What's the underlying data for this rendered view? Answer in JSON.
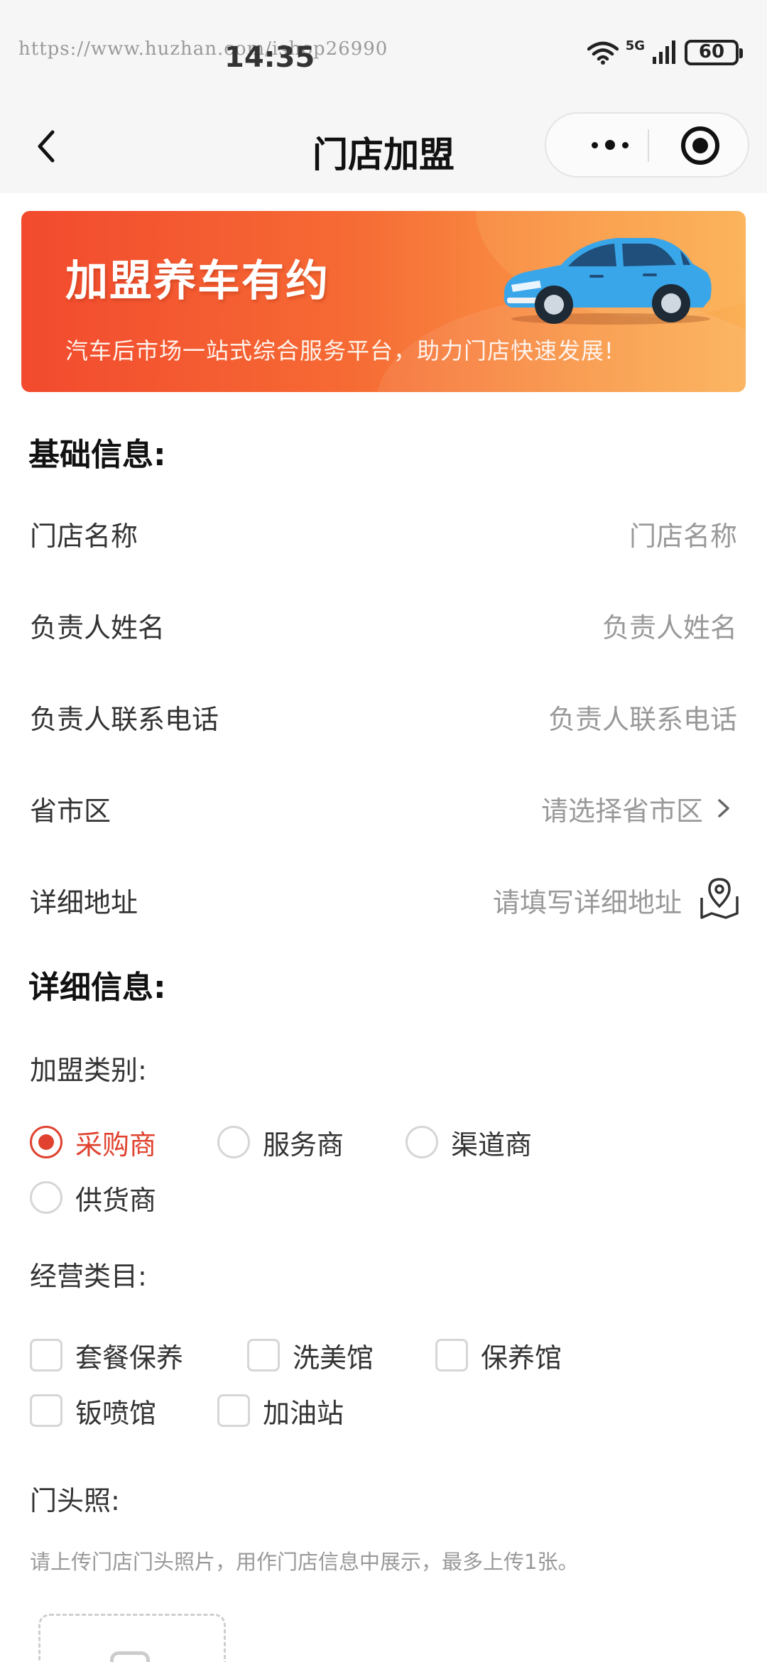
{
  "status_bar": {
    "watermark": "https://www.huzhan.com/ishop26990",
    "time": "14:35",
    "network": "5G",
    "battery": "60"
  },
  "nav": {
    "title": "门店加盟"
  },
  "banner": {
    "title": "加盟养车有约",
    "subtitle": "汽车后市场一站式综合服务平台，助力门店快速发展!"
  },
  "basic_info": {
    "section_title": "基础信息:",
    "fields": [
      {
        "label": "门店名称",
        "placeholder": "门店名称"
      },
      {
        "label": "负责人姓名",
        "placeholder": "负责人姓名"
      },
      {
        "label": "负责人联系电话",
        "placeholder": "负责人联系电话"
      },
      {
        "label": "省市区",
        "placeholder": "请选择省市区"
      },
      {
        "label": "详细地址",
        "placeholder": "请填写详细地址"
      }
    ]
  },
  "detail_info": {
    "section_title": "详细信息:",
    "category_label": "加盟类别:",
    "categories": [
      {
        "label": "采购商",
        "selected": true
      },
      {
        "label": "服务商",
        "selected": false
      },
      {
        "label": "渠道商",
        "selected": false
      },
      {
        "label": "供货商",
        "selected": false
      }
    ],
    "business_label": "经营类目:",
    "businesses": [
      {
        "label": "套餐保养",
        "checked": false
      },
      {
        "label": "洗美馆",
        "checked": false
      },
      {
        "label": "保养馆",
        "checked": false
      },
      {
        "label": "钣喷馆",
        "checked": false
      },
      {
        "label": "加油站",
        "checked": false
      }
    ],
    "photo_label": "门头照:",
    "photo_hint": "请上传门店门头照片，用作门店信息中展示，最多上传1张。"
  },
  "colors": {
    "accent": "#e0422f",
    "banner_start": "#f24a2e",
    "banner_end": "#fbb056"
  },
  "icons": [
    "back-arrow-icon",
    "more-dots-icon",
    "target-icon",
    "chevron-right-icon",
    "map-icon",
    "camera-icon",
    "wifi-icon",
    "signal-icon",
    "battery-icon"
  ]
}
